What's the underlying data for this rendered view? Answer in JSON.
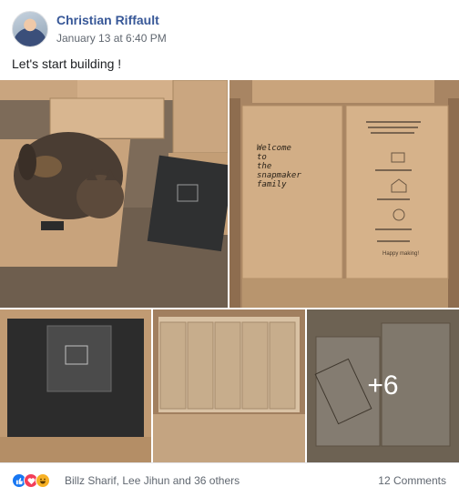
{
  "post": {
    "author": "Christian Riffault",
    "timestamp": "January 13 at 6:40 PM",
    "message": "Let's start building !"
  },
  "photos": {
    "box_welcome_text": "Welcome\nto\nthe\nsnapmaker\nfamily",
    "box_slogan": "Happy making!",
    "more_count": "+6"
  },
  "footer": {
    "reaction_icons": [
      "like-icon",
      "love-icon",
      "haha-icon"
    ],
    "reaction_names": "Billz Sharif, Lee Jihun and 36 others",
    "comments": "12 Comments"
  },
  "colors": {
    "author_link": "#385898",
    "meta_text": "#606770",
    "like": "#1877f2",
    "love": "#f33e58",
    "haha": "#f7b125"
  }
}
